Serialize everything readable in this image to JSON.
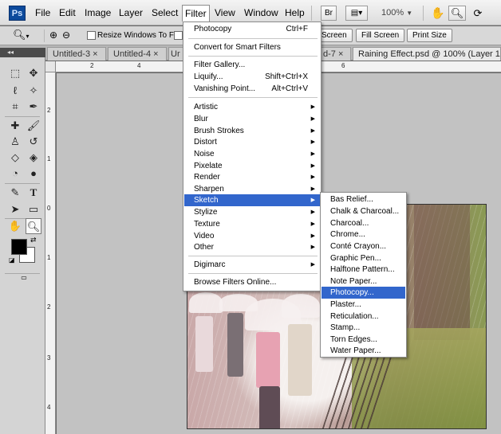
{
  "app": {
    "logo": "Ps"
  },
  "menubar": {
    "items": [
      "File",
      "Edit",
      "Image",
      "Layer",
      "Select",
      "Filter",
      "View",
      "Window",
      "Help"
    ],
    "bridge_label": "Br",
    "zoom": "100%"
  },
  "options": {
    "resize_windows_label": "Resize Windows To Fit",
    "screen_label": "Screen",
    "fill_screen_label": "Fill Screen",
    "print_size_label": "Print Size"
  },
  "tabs": [
    {
      "label": "Untitled-3 ×"
    },
    {
      "label": "Untitled-4 ×"
    },
    {
      "label": "Ur"
    },
    {
      "label": "d-7 ×"
    },
    {
      "label": "Raining Effect.psd @ 100% (Layer 1,"
    }
  ],
  "tools": {
    "header": "◂◂"
  },
  "rulers": {
    "top": [
      "2",
      "4",
      "6"
    ],
    "left": [
      "2",
      "1",
      "0",
      "1",
      "2",
      "3",
      "4"
    ]
  },
  "filter_menu": {
    "last_filter": {
      "label": "Photocopy",
      "shortcut": "Ctrl+F"
    },
    "convert": "Convert for Smart Filters",
    "gallery": "Filter Gallery...",
    "liquify": {
      "label": "Liquify...",
      "shortcut": "Shift+Ctrl+X"
    },
    "vanishing": {
      "label": "Vanishing Point...",
      "shortcut": "Alt+Ctrl+V"
    },
    "groups": [
      "Artistic",
      "Blur",
      "Brush Strokes",
      "Distort",
      "Noise",
      "Pixelate",
      "Render",
      "Sharpen",
      "Sketch",
      "Stylize",
      "Texture",
      "Video",
      "Other"
    ],
    "digimarc": "Digimarc",
    "browse": "Browse Filters Online..."
  },
  "sketch_menu": {
    "items": [
      "Bas Relief...",
      "Chalk & Charcoal...",
      "Charcoal...",
      "Chrome...",
      "Conté Crayon...",
      "Graphic Pen...",
      "Halftone Pattern...",
      "Note Paper...",
      "Photocopy...",
      "Plaster...",
      "Reticulation...",
      "Stamp...",
      "Torn Edges...",
      "Water Paper..."
    ],
    "selected": "Photocopy..."
  },
  "colors": {
    "highlight": "#3266cc"
  }
}
